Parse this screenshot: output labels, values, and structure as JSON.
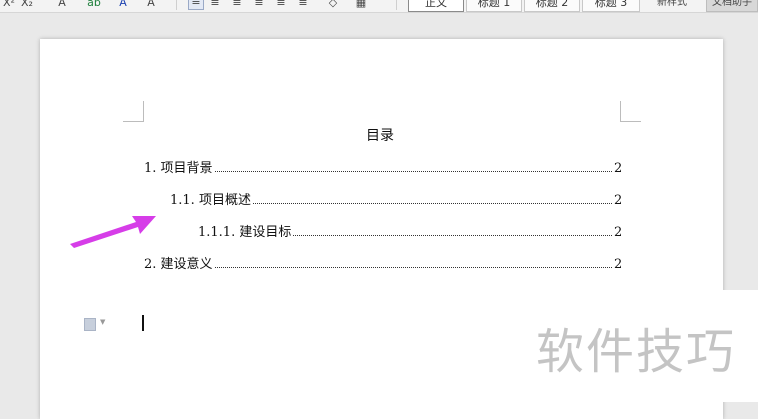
{
  "toolbar": {
    "font_buttons": [
      "X²",
      "X₂",
      "A",
      "ab",
      "A",
      "A"
    ],
    "styles": [
      {
        "label": "正文",
        "selected": true
      },
      {
        "label": "标题 1",
        "selected": false
      },
      {
        "label": "标题 2",
        "selected": false
      },
      {
        "label": "标题 3",
        "selected": false
      }
    ],
    "new_style_label": "新样式",
    "assistant_label": "文档助手"
  },
  "document": {
    "toc_title": "目录",
    "toc": [
      {
        "num": "1. ",
        "text": "项目背景",
        "page": "2"
      },
      {
        "num": "1.1. ",
        "text": "项目概述",
        "page": "2"
      },
      {
        "num": "1.1.1. ",
        "text": "建设目标",
        "page": "2"
      },
      {
        "num": "2. ",
        "text": "建设意义",
        "page": "2"
      }
    ]
  },
  "watermark": "软件技巧",
  "colors": {
    "arrow": "#d63de8",
    "watermark": "#c4c4c4",
    "page": "#ffffff"
  }
}
